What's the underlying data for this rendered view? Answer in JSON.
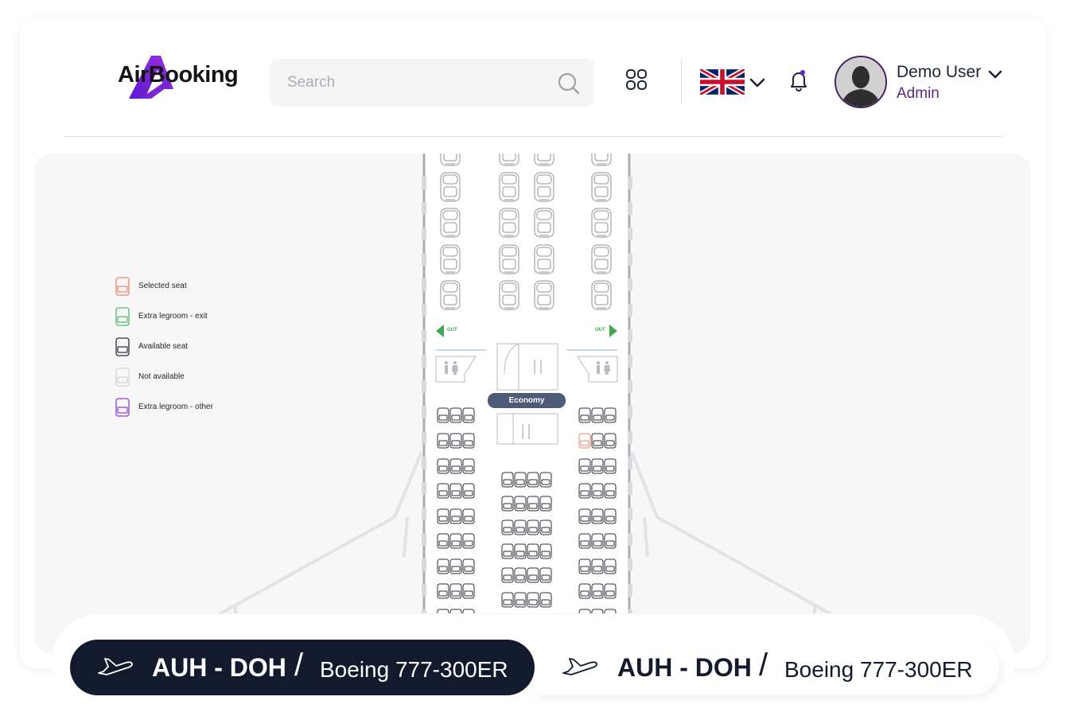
{
  "header": {
    "logo_text": "AirBooking",
    "search_placeholder": "Search",
    "user_name": "Demo User",
    "user_role": "Admin",
    "language_flag": "uk-flag-icon"
  },
  "colors": {
    "brand_purple": "#6a1fd6",
    "selected_seat": "#e8866a",
    "extra_legroom_exit": "#55b86a",
    "available_seat": "#2b2f36",
    "not_available": "#d3d5d9",
    "extra_legroom_other": "#8b3fd1",
    "economy_badge": "#4d5a78",
    "active_tab": "#141a2e"
  },
  "legend": [
    {
      "label": "Selected seat",
      "status": "selected"
    },
    {
      "label": "Extra legroom - exit",
      "status": "exit"
    },
    {
      "label": "Available seat",
      "status": "available"
    },
    {
      "label": "Not available",
      "status": "unavailable"
    },
    {
      "label": "Extra legroom - other",
      "status": "other"
    }
  ],
  "seatmap": {
    "cabin_label": "Economy",
    "exit_left": "OUT",
    "exit_right": "OUT"
  },
  "flights": [
    {
      "route": "AUH - DOH",
      "separator": "/",
      "aircraft": "Boeing 777-300ER",
      "active": true
    },
    {
      "route": "AUH - DOH",
      "separator": "/",
      "aircraft": "Boeing 777-300ER",
      "active": false
    }
  ]
}
